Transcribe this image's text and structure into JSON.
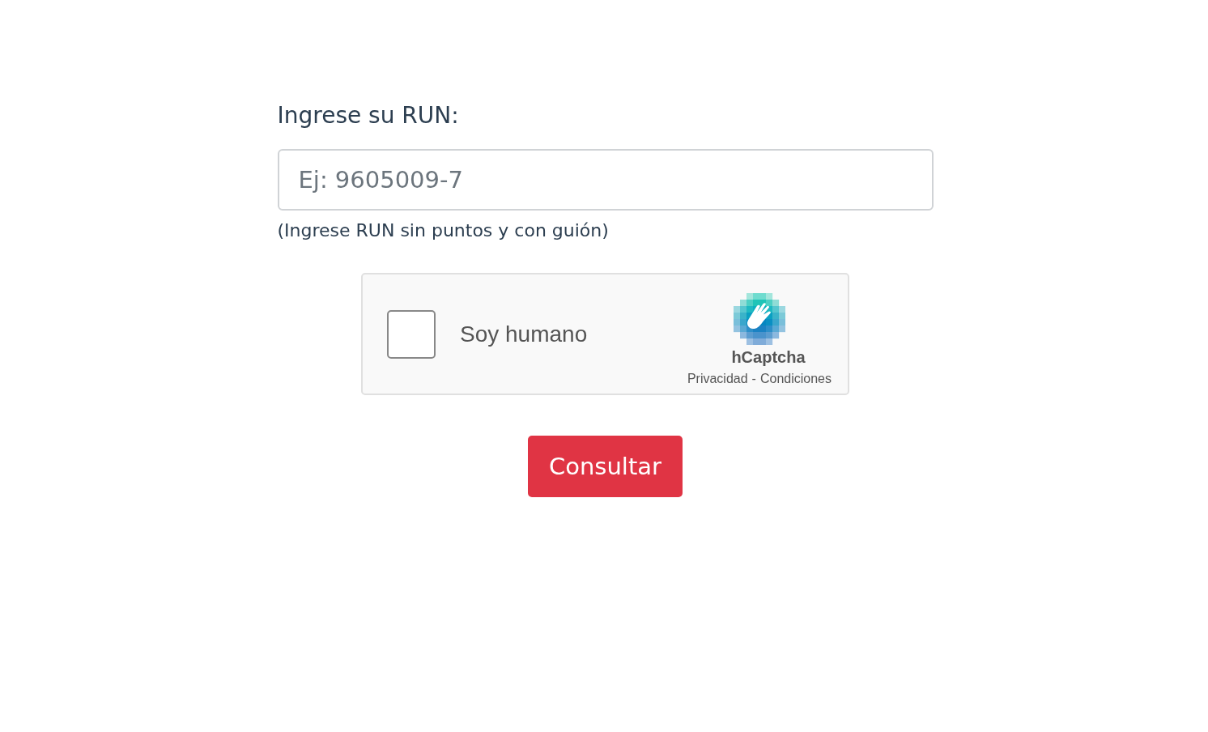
{
  "run_field": {
    "label": "Ingrese su RUN:",
    "placeholder": "Ej: 9605009-7",
    "hint": "(Ingrese RUN sin puntos y con guión)"
  },
  "captcha": {
    "checkbox_label": "Soy humano",
    "checked": false,
    "brand": "hCaptcha",
    "links": [
      "Privacidad",
      "Condiciones"
    ],
    "separator": "-"
  },
  "submit_button": "Consultar"
}
